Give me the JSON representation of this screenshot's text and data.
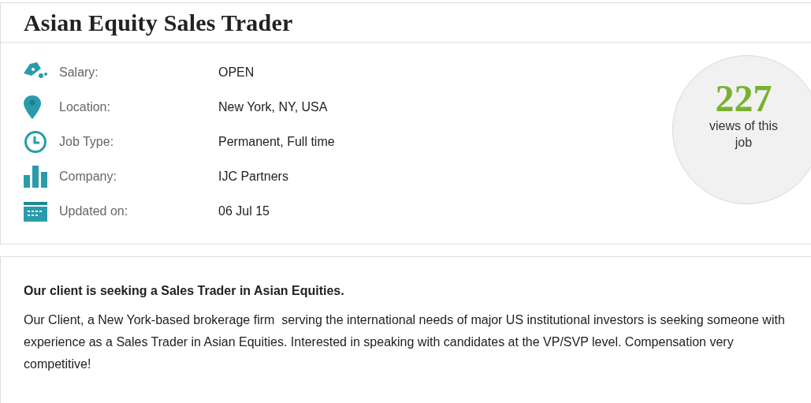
{
  "title": "Asian Equity Sales Trader",
  "details": [
    {
      "label": "Salary:",
      "value": "OPEN"
    },
    {
      "label": "Location:",
      "value": "New York, NY, USA"
    },
    {
      "label": "Job Type:",
      "value": "Permanent, Full time"
    },
    {
      "label": "Company:",
      "value": "IJC Partners"
    },
    {
      "label": "Updated on:",
      "value": "06 Jul 15"
    }
  ],
  "views": {
    "count": "227",
    "caption": "views of this job"
  },
  "description": {
    "heading": "Our client is seeking a Sales Trader in Asian Equities.",
    "body": "Our Client, a New York-based brokerage firm  serving the international needs of major US institutional investors is seeking someone with experience as a Sales Trader in Asian Equities. Interested in speaking with candidates at the VP/SVP level. Compensation very competitive!"
  }
}
